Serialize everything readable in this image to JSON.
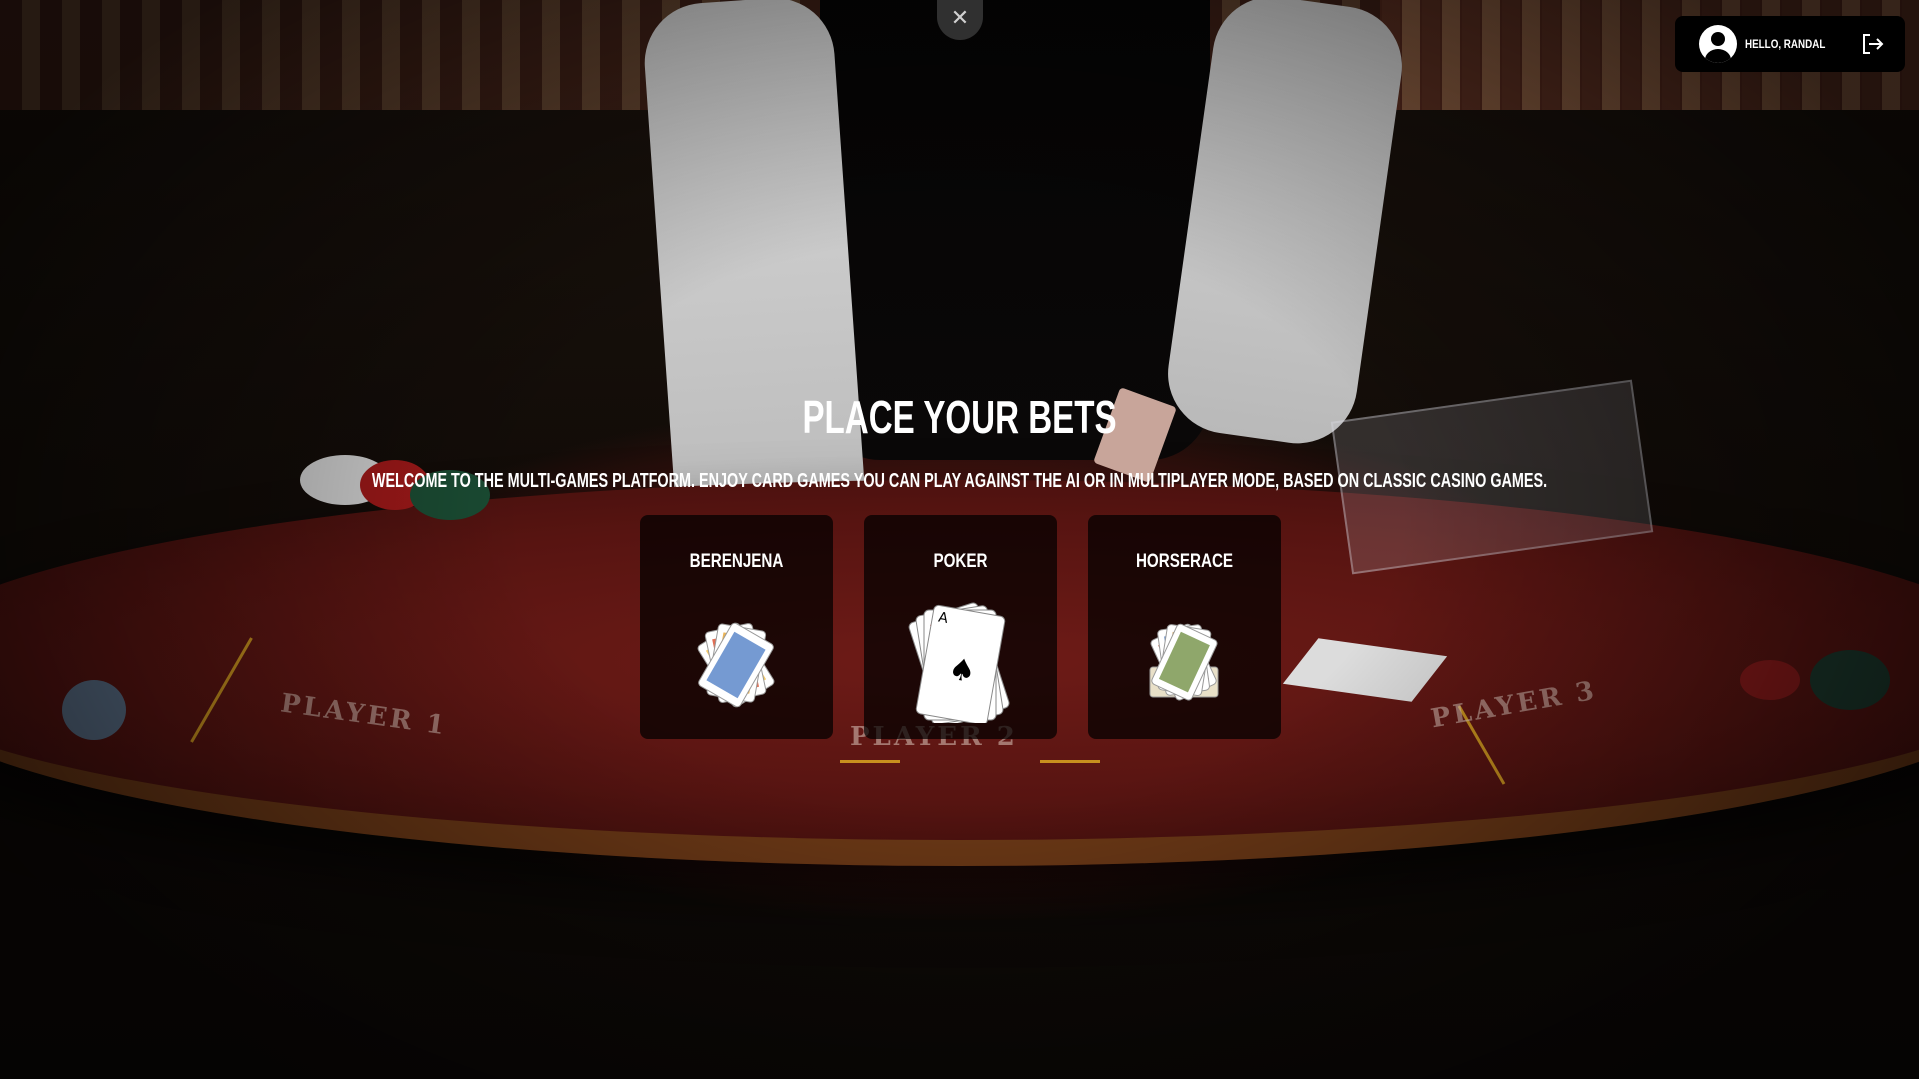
{
  "header": {
    "close_symbol": "✕",
    "user_greeting": "Hello, Randal",
    "avatar_icon": "user-circle-icon",
    "logout_icon": "logout-icon"
  },
  "hero": {
    "title": "Place your bets",
    "subtitle": "Welcome to the multi-games platform. Enjoy card games you can play against the AI or in multiplayer mode, based on classic casino games."
  },
  "games": [
    {
      "label": "Berenjena",
      "icon": "spanish-cards-icon"
    },
    {
      "label": "Poker",
      "icon": "four-aces-icon"
    },
    {
      "label": "Horserace",
      "icon": "horse-cards-icon"
    }
  ],
  "colors": {
    "card_background": "#000000",
    "text": "#ffffff",
    "felt": "#571411",
    "table_lines": "#c7901e"
  }
}
